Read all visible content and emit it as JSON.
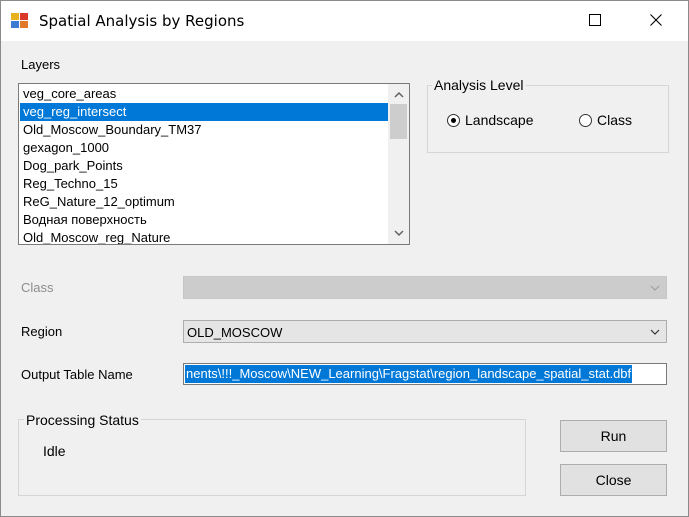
{
  "window": {
    "title": "Spatial Analysis by Regions"
  },
  "layers": {
    "label": "Layers",
    "items": [
      "veg_core_areas",
      "veg_reg_intersect",
      "Old_Moscow_Boundary_TM37",
      "gexagon_1000",
      "Dog_park_Points",
      "Reg_Techno_15",
      "ReG_Nature_12_optimum",
      "Водная поверхность",
      "Old_Moscow_reg_Nature"
    ],
    "selected_index": 1
  },
  "analysis_level": {
    "label": "Analysis Level",
    "options": [
      "Landscape",
      "Class"
    ],
    "selected": "Landscape"
  },
  "class_field": {
    "label": "Class",
    "value": ""
  },
  "region": {
    "label": "Region",
    "value": "OLD_MOSCOW"
  },
  "output": {
    "label": "Output Table Name",
    "value": "nents\\!!!_Moscow\\NEW_Learning\\Fragstat\\region_landscape_spatial_stat.dbf"
  },
  "processing": {
    "label": "Processing Status",
    "status": "Idle"
  },
  "buttons": {
    "run": "Run",
    "close": "Close"
  },
  "colors": {
    "selection": "#0078d7",
    "window_bg": "#f0f0f0"
  }
}
